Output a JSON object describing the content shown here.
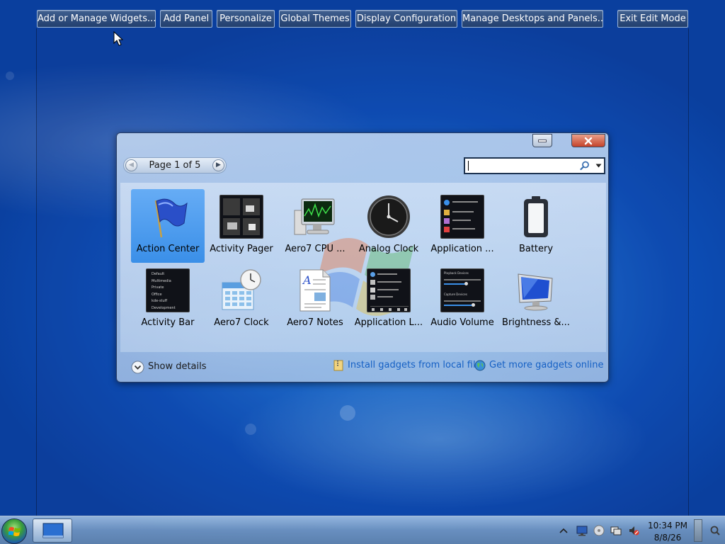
{
  "toolbar": {
    "add_manage_widgets": "Add or Manage Widgets...",
    "add_panel": "Add Panel",
    "personalize": "Personalize",
    "global_themes": "Global Themes",
    "display_configuration": "Display Configuration",
    "manage_desktops": "Manage Desktops and Panels...",
    "exit_edit_mode": "Exit Edit Mode"
  },
  "explorer": {
    "page_label": "Page 1 of 5",
    "search_value": "",
    "widgets": [
      {
        "label": "Action Center",
        "icon": "flag-icon",
        "selected": true
      },
      {
        "label": "Activity Pager",
        "icon": "pager-icon"
      },
      {
        "label": "Aero7 CPU ...",
        "icon": "cpu-monitor-icon"
      },
      {
        "label": "Analog Clock",
        "icon": "analog-clock-icon"
      },
      {
        "label": "Application ...",
        "icon": "application-menu-icon"
      },
      {
        "label": "Battery",
        "icon": "battery-icon"
      },
      {
        "label": "Activity Bar",
        "icon": "activity-bar-icon"
      },
      {
        "label": "Aero7 Clock",
        "icon": "calendar-clock-icon"
      },
      {
        "label": "Aero7 Notes",
        "icon": "notes-icon"
      },
      {
        "label": "Application L...",
        "icon": "application-launcher-icon"
      },
      {
        "label": "Audio Volume",
        "icon": "audio-volume-icon"
      },
      {
        "label": "Brightness &...",
        "icon": "monitor-brightness-icon"
      }
    ],
    "show_details": "Show details",
    "install_local": "Install gadgets from local file",
    "get_online": "Get more gadgets online"
  },
  "thumb_text": {
    "activity_bar_items": [
      "Default",
      "Multimedia",
      "Private",
      "Office",
      "kde-stuff",
      "Development"
    ],
    "audio_playback": "Playback Devices",
    "audio_capture": "Capture Devices"
  },
  "taskbar": {
    "time": "10:34 PM",
    "date": "8/8/26"
  },
  "colors": {
    "accent": "#3a8fe8",
    "link": "#1560c4",
    "close_button": "#c5432a"
  }
}
